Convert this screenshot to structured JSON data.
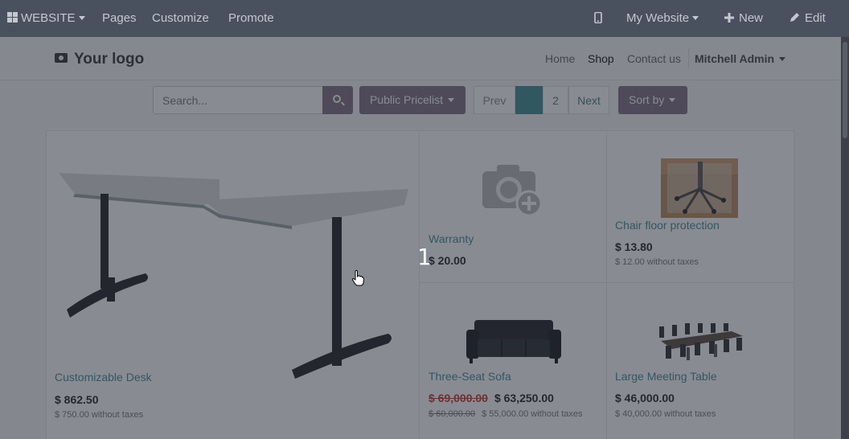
{
  "topbar": {
    "website_menu": "WEBSITE",
    "pages": "Pages",
    "customize": "Customize",
    "promote": "Promote",
    "site_switcher": "My Website",
    "new": "New",
    "edit": "Edit"
  },
  "header": {
    "logo": "Your logo",
    "nav": {
      "home": "Home",
      "shop": "Shop",
      "contact": "Contact us",
      "user": "Mitchell Admin"
    }
  },
  "toolbar": {
    "search_placeholder": "Search...",
    "pricelist": "Public Pricelist",
    "pager": {
      "prev": "Prev",
      "page1": "1",
      "page2": "2",
      "next": "Next"
    },
    "sort": "Sort by"
  },
  "products": [
    {
      "name": "Customizable Desk",
      "price": "$ 862.50",
      "sub": "$ 750.00 without taxes"
    },
    {
      "name": "Warranty",
      "price": "$ 20.00"
    },
    {
      "name": "Chair floor protection",
      "price": "$ 13.80",
      "sub": "$ 12.00 without taxes"
    },
    {
      "name": "Three-Seat Sofa",
      "old_price": "$ 69,000.00",
      "price": "$ 63,250.00",
      "old_sub": "$ 60,000.00",
      "sub": "$ 55,000.00 without taxes"
    },
    {
      "name": "Large Meeting Table",
      "price": "$ 46,000.00",
      "sub": "$ 40,000.00 without taxes"
    }
  ],
  "tour": {
    "step": "1"
  },
  "colors": {
    "admin_bar": "#49505e",
    "primary": "#7c6f80",
    "link": "#3e8a94",
    "strike": "#c0392b"
  },
  "icons": [
    "grid-icon",
    "mobile-icon",
    "plus-icon",
    "pencil-icon",
    "camera-icon",
    "search-icon",
    "caret-icon",
    "hand-cursor-icon"
  ]
}
